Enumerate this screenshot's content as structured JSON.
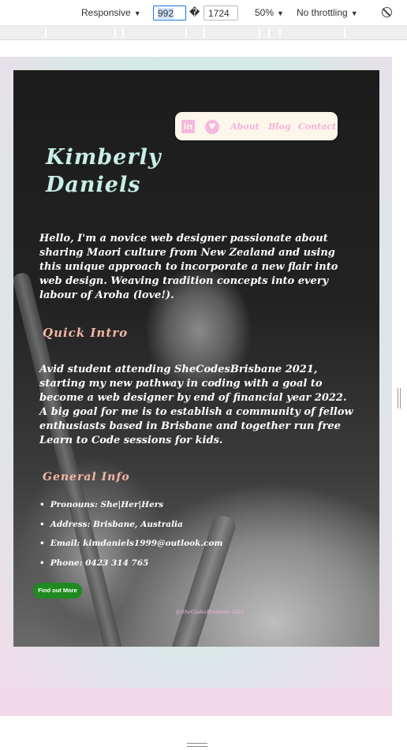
{
  "devtools": {
    "device": "Responsive",
    "width": "992",
    "separator": "�",
    "height": "1724",
    "zoom": "50%",
    "throttling": "No throttling"
  },
  "nav": {
    "linkedin_icon": "linkedin-icon",
    "heart_icon": "heart-icon",
    "links": [
      "About",
      "Blog",
      "Contact"
    ]
  },
  "hero": {
    "name_line1": "Kimberly",
    "name_line2": "Daniels",
    "intro": "Hello, I'm a novice web designer passionate about sharing Maori culture from New Zealand and using this unique approach to incorporate a new flair into web design. Weaving tradition concepts into every labour of Aroha (love!).",
    "quick_intro_heading": "Quick Intro",
    "quick_intro": "Avid student attending SheCodesBrisbane 2021, starting my new pathway in coding with a goal to become a web designer by end of financial year 2022. A big goal for me is to establish a community of fellow enthusiasts based in Brisbane and together run free Learn to Code sessions for kids.",
    "general_info_heading": "General Info",
    "info": [
      "Pronouns: She|Her|Hers",
      "Address: Brisbane, Australia",
      "Email: kimdaniels1999@outlook.com",
      "Phone: 0423 314 765"
    ],
    "cta_label": "Find out More",
    "credit": "@SheCodesBrisbane 2021"
  },
  "colors": {
    "name": "#c7efe6",
    "heading": "#f5b7a4",
    "nav_link": "#f3b3db",
    "cta": "#1f8a1f"
  }
}
